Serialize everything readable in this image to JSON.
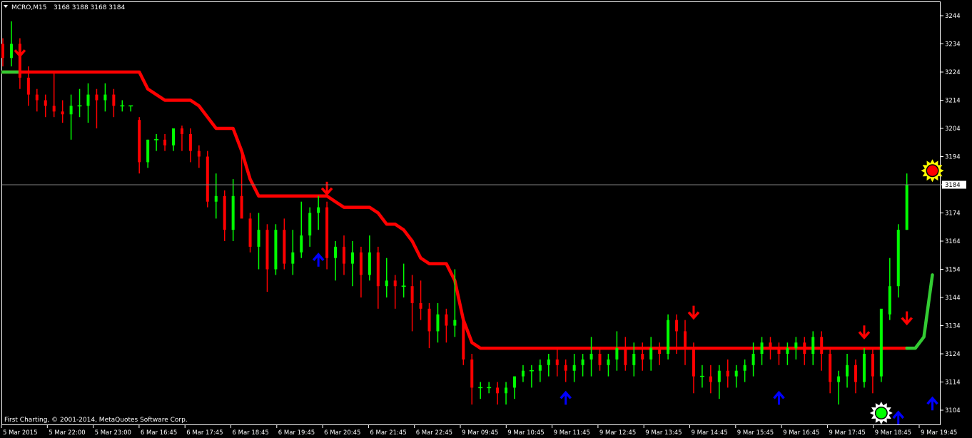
{
  "header": {
    "symbol_label": "MCRO,M15",
    "ohlc_label": "3168 3188 3168 3184"
  },
  "footer": {
    "copyright": "First Charting, © 2001-2014, MetaQuotes Software Corp."
  },
  "price_marker": {
    "label": "3184",
    "value": 3184
  },
  "colors": {
    "background": "#000000",
    "bull": "#00ff00",
    "bear": "#ff0000",
    "trail_bear": "#ff0000",
    "trail_bull": "#33cc33",
    "up_arrow": "#0000ff",
    "down_arrow": "#ff0000",
    "axis": "#ffffff",
    "grid_line": "#808080"
  },
  "chart_data": {
    "type": "candlestick",
    "y_ticks": [
      3244,
      3234,
      3224,
      3214,
      3204,
      3194,
      3184,
      3174,
      3164,
      3154,
      3144,
      3134,
      3124,
      3114,
      3104
    ],
    "x_ticks": [
      "5 Mar 2015",
      "5 Mar 22:00",
      "5 Mar 23:00",
      "6 Mar 16:45",
      "6 Mar 17:45",
      "6 Mar 18:45",
      "6 Mar 19:45",
      "6 Mar 20:45",
      "6 Mar 21:45",
      "6 Mar 22:45",
      "9 Mar 09:45",
      "9 Mar 10:45",
      "9 Mar 11:45",
      "9 Mar 12:45",
      "9 Mar 13:45",
      "9 Mar 14:45",
      "9 Mar 15:45",
      "9 Mar 16:45",
      "9 Mar 17:45",
      "9 Mar 18:45",
      "9 Mar 19:45"
    ],
    "ylim": [
      3100,
      3248
    ],
    "bars": [
      [
        3234,
        3236,
        3226,
        3229
      ],
      [
        3229,
        3242,
        3226,
        3234
      ],
      [
        3234,
        3236,
        3218,
        3222
      ],
      [
        3222,
        3226,
        3212,
        3216
      ],
      [
        3216,
        3218,
        3210,
        3214
      ],
      [
        3214,
        3216,
        3208,
        3212
      ],
      [
        3212,
        3224,
        3208,
        3210
      ],
      [
        3210,
        3214,
        3206,
        3209
      ],
      [
        3209,
        3216,
        3200,
        3212
      ],
      [
        3212,
        3218,
        3208,
        3212
      ],
      [
        3212,
        3220,
        3206,
        3216
      ],
      [
        3216,
        3218,
        3204,
        3214
      ],
      [
        3214,
        3220,
        3210,
        3216
      ],
      [
        3216,
        3218,
        3208,
        3212
      ],
      [
        3212,
        3214,
        3210,
        3212
      ],
      [
        3212,
        3212,
        3210,
        3212
      ],
      [
        3207,
        3208,
        3188,
        3192
      ],
      [
        3192,
        3200,
        3190,
        3200
      ],
      [
        3200,
        3202,
        3196,
        3200
      ],
      [
        3200,
        3202,
        3196,
        3198
      ],
      [
        3198,
        3204,
        3196,
        3204
      ],
      [
        3204,
        3205,
        3196,
        3202
      ],
      [
        3202,
        3204,
        3192,
        3196
      ],
      [
        3196,
        3198,
        3190,
        3194
      ],
      [
        3194,
        3196,
        3176,
        3178
      ],
      [
        3178,
        3188,
        3172,
        3180
      ],
      [
        3180,
        3182,
        3164,
        3168
      ],
      [
        3168,
        3186,
        3164,
        3180
      ],
      [
        3180,
        3196,
        3174,
        3172
      ],
      [
        3172,
        3174,
        3160,
        3162
      ],
      [
        3162,
        3174,
        3154,
        3168
      ],
      [
        3168,
        3170,
        3146,
        3154
      ],
      [
        3154,
        3170,
        3152,
        3168
      ],
      [
        3168,
        3172,
        3154,
        3156
      ],
      [
        3156,
        3168,
        3152,
        3160
      ],
      [
        3160,
        3178,
        3158,
        3166
      ],
      [
        3166,
        3176,
        3162,
        3174
      ],
      [
        3174,
        3180,
        3168,
        3176
      ],
      [
        3176,
        3178,
        3154,
        3158
      ],
      [
        3158,
        3164,
        3150,
        3162
      ],
      [
        3162,
        3166,
        3152,
        3156
      ],
      [
        3156,
        3164,
        3148,
        3160
      ],
      [
        3160,
        3162,
        3144,
        3152
      ],
      [
        3152,
        3166,
        3150,
        3160
      ],
      [
        3160,
        3162,
        3140,
        3148
      ],
      [
        3148,
        3158,
        3144,
        3150
      ],
      [
        3150,
        3152,
        3140,
        3148
      ],
      [
        3148,
        3156,
        3144,
        3148
      ],
      [
        3148,
        3152,
        3132,
        3142
      ],
      [
        3142,
        3150,
        3136,
        3140
      ],
      [
        3140,
        3142,
        3126,
        3132
      ],
      [
        3132,
        3142,
        3128,
        3138
      ],
      [
        3138,
        3140,
        3128,
        3134
      ],
      [
        3134,
        3154,
        3130,
        3136
      ],
      [
        3136,
        3138,
        3120,
        3122
      ],
      [
        3122,
        3124,
        3106,
        3112
      ],
      [
        3112,
        3114,
        3108,
        3112
      ],
      [
        3112,
        3114,
        3110,
        3112
      ],
      [
        3112,
        3114,
        3106,
        3110
      ],
      [
        3110,
        3114,
        3106,
        3112
      ],
      [
        3112,
        3116,
        3108,
        3116
      ],
      [
        3116,
        3120,
        3114,
        3118
      ],
      [
        3118,
        3120,
        3112,
        3118
      ],
      [
        3118,
        3122,
        3114,
        3120
      ],
      [
        3120,
        3124,
        3116,
        3122
      ],
      [
        3122,
        3126,
        3116,
        3120
      ],
      [
        3120,
        3122,
        3114,
        3118
      ],
      [
        3118,
        3124,
        3114,
        3120
      ],
      [
        3120,
        3124,
        3116,
        3122
      ],
      [
        3122,
        3130,
        3116,
        3124
      ],
      [
        3124,
        3126,
        3118,
        3120
      ],
      [
        3120,
        3124,
        3116,
        3122
      ],
      [
        3122,
        3132,
        3118,
        3126
      ],
      [
        3126,
        3130,
        3118,
        3120
      ],
      [
        3120,
        3128,
        3116,
        3124
      ],
      [
        3124,
        3128,
        3118,
        3122
      ],
      [
        3122,
        3130,
        3118,
        3126
      ],
      [
        3126,
        3128,
        3120,
        3124
      ],
      [
        3124,
        3138,
        3122,
        3136
      ],
      [
        3136,
        3138,
        3124,
        3132
      ],
      [
        3132,
        3136,
        3120,
        3126
      ],
      [
        3126,
        3128,
        3110,
        3116
      ],
      [
        3116,
        3120,
        3112,
        3116
      ],
      [
        3116,
        3120,
        3110,
        3114
      ],
      [
        3114,
        3120,
        3108,
        3118
      ],
      [
        3118,
        3122,
        3112,
        3116
      ],
      [
        3116,
        3120,
        3112,
        3118
      ],
      [
        3118,
        3122,
        3114,
        3120
      ],
      [
        3120,
        3128,
        3116,
        3124
      ],
      [
        3124,
        3130,
        3120,
        3128
      ],
      [
        3128,
        3130,
        3122,
        3126
      ],
      [
        3126,
        3128,
        3120,
        3124
      ],
      [
        3124,
        3128,
        3120,
        3126
      ],
      [
        3126,
        3130,
        3122,
        3128
      ],
      [
        3128,
        3130,
        3120,
        3124
      ],
      [
        3124,
        3132,
        3120,
        3130
      ],
      [
        3130,
        3132,
        3118,
        3124
      ],
      [
        3124,
        3126,
        3110,
        3114
      ],
      [
        3114,
        3118,
        3106,
        3116
      ],
      [
        3116,
        3124,
        3112,
        3120
      ],
      [
        3120,
        3122,
        3110,
        3114
      ],
      [
        3114,
        3126,
        3112,
        3124
      ],
      [
        3124,
        3126,
        3110,
        3116
      ],
      [
        3116,
        3134,
        3114,
        3140
      ],
      [
        3138,
        3158,
        3136,
        3148
      ],
      [
        3148,
        3170,
        3144,
        3168
      ],
      [
        3168,
        3188,
        3168,
        3184
      ]
    ],
    "trail_line": {
      "points": [
        [
          0,
          3224
        ],
        [
          1,
          3224
        ],
        [
          2,
          3224
        ],
        [
          3,
          3224
        ],
        [
          4,
          3224
        ],
        [
          5,
          3224
        ],
        [
          6,
          3224
        ],
        [
          7,
          3224
        ],
        [
          8,
          3224
        ],
        [
          9,
          3224
        ],
        [
          10,
          3224
        ],
        [
          11,
          3224
        ],
        [
          12,
          3224
        ],
        [
          13,
          3224
        ],
        [
          14,
          3224
        ],
        [
          15,
          3224
        ],
        [
          16,
          3224
        ],
        [
          17,
          3218
        ],
        [
          18,
          3216
        ],
        [
          19,
          3214
        ],
        [
          20,
          3214
        ],
        [
          21,
          3214
        ],
        [
          22,
          3214
        ],
        [
          23,
          3212
        ],
        [
          24,
          3208
        ],
        [
          25,
          3204
        ],
        [
          26,
          3204
        ],
        [
          27,
          3204
        ],
        [
          28,
          3196
        ],
        [
          29,
          3186
        ],
        [
          30,
          3180
        ],
        [
          31,
          3180
        ],
        [
          32,
          3180
        ],
        [
          33,
          3180
        ],
        [
          34,
          3180
        ],
        [
          35,
          3180
        ],
        [
          36,
          3180
        ],
        [
          37,
          3180
        ],
        [
          38,
          3180
        ],
        [
          39,
          3178
        ],
        [
          40,
          3176
        ],
        [
          41,
          3176
        ],
        [
          42,
          3176
        ],
        [
          43,
          3176
        ],
        [
          44,
          3174
        ],
        [
          45,
          3170
        ],
        [
          46,
          3170
        ],
        [
          47,
          3168
        ],
        [
          48,
          3164
        ],
        [
          49,
          3158
        ],
        [
          50,
          3156
        ],
        [
          51,
          3156
        ],
        [
          52,
          3156
        ],
        [
          53,
          3150
        ],
        [
          54,
          3136
        ],
        [
          55,
          3128
        ],
        [
          56,
          3126
        ],
        [
          57,
          3126
        ],
        [
          58,
          3126
        ],
        [
          59,
          3126
        ],
        [
          60,
          3126
        ],
        [
          61,
          3126
        ],
        [
          62,
          3126
        ],
        [
          63,
          3126
        ],
        [
          64,
          3126
        ],
        [
          65,
          3126
        ],
        [
          66,
          3126
        ],
        [
          67,
          3126
        ],
        [
          68,
          3126
        ],
        [
          69,
          3126
        ],
        [
          70,
          3126
        ],
        [
          71,
          3126
        ],
        [
          72,
          3126
        ],
        [
          73,
          3126
        ],
        [
          74,
          3126
        ],
        [
          75,
          3126
        ],
        [
          76,
          3126
        ],
        [
          77,
          3126
        ],
        [
          78,
          3126
        ],
        [
          79,
          3126
        ],
        [
          80,
          3126
        ],
        [
          81,
          3126
        ],
        [
          82,
          3126
        ],
        [
          83,
          3126
        ],
        [
          84,
          3126
        ],
        [
          85,
          3126
        ],
        [
          86,
          3126
        ],
        [
          87,
          3126
        ],
        [
          88,
          3126
        ],
        [
          89,
          3126
        ],
        [
          90,
          3126
        ],
        [
          91,
          3126
        ],
        [
          92,
          3126
        ],
        [
          93,
          3126
        ],
        [
          94,
          3126
        ],
        [
          95,
          3126
        ],
        [
          96,
          3126
        ],
        [
          97,
          3126
        ],
        [
          98,
          3126
        ],
        [
          99,
          3126
        ],
        [
          100,
          3126
        ],
        [
          101,
          3126
        ],
        [
          102,
          3126
        ],
        [
          103,
          3126
        ],
        [
          104,
          3126
        ],
        [
          105,
          3126
        ],
        [
          106,
          3126
        ],
        [
          107,
          3126
        ],
        [
          108,
          3130
        ],
        [
          109,
          3152
        ]
      ],
      "bull_from_index": 106
    },
    "signals": {
      "down_arrows": [
        [
          2,
          3229
        ],
        [
          38,
          3180
        ],
        [
          81,
          3136
        ],
        [
          101,
          3129
        ],
        [
          106,
          3134
        ]
      ],
      "up_arrows": [
        [
          37,
          3160
        ],
        [
          66,
          3111
        ],
        [
          91,
          3111
        ],
        [
          105,
          3104
        ],
        [
          109,
          3109
        ]
      ],
      "suns": [
        {
          "index": 109,
          "value": 3189,
          "ring": "#ffff00",
          "core": "#ff0000"
        },
        {
          "index": 103,
          "value": 3103,
          "ring": "#ffffff",
          "core": "#00ff00"
        }
      ]
    }
  }
}
